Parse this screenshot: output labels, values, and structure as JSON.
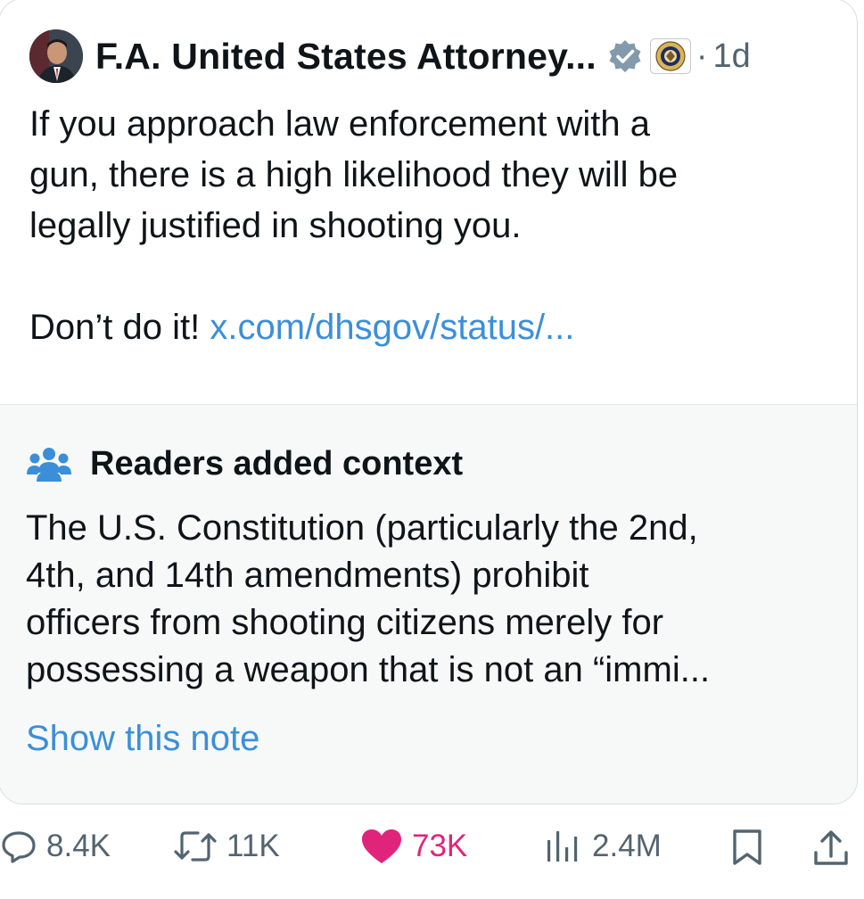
{
  "post": {
    "author": "F.A. United States Attorney...",
    "separator": "·",
    "time": "1d",
    "text_line1": "If you approach law enforcement with a",
    "text_line2": "gun, there is a high likelihood they will be",
    "text_line3": "legally justified in shooting you.",
    "text_prefix": "Don’t do it! ",
    "link_text": "x.com/dhsgov/status/..."
  },
  "note": {
    "title": "Readers added context",
    "line1": "The U.S. Constitution (particularly the 2nd,",
    "line2": "4th, and 14th amendments) prohibit",
    "line3": "officers from shooting citizens merely for",
    "line4": "possessing a weapon that is not an “immi...",
    "show_label": "Show this note"
  },
  "actions": {
    "replies": "8.4K",
    "reposts": "11K",
    "likes": "73K",
    "views": "2.4M"
  },
  "icons": {
    "avatar": "avatar",
    "verified": "verified-badge-icon",
    "seal": "doj-seal-icon",
    "people": "people-icon",
    "reply": "reply-icon",
    "repost": "repost-icon",
    "like": "heart-icon",
    "views": "views-chart-icon",
    "bookmark": "bookmark-icon",
    "share": "share-icon"
  },
  "colors": {
    "link": "#3b8fd9",
    "like": "#e0247b",
    "muted": "#536471",
    "note_bg": "#f7f9f9"
  }
}
